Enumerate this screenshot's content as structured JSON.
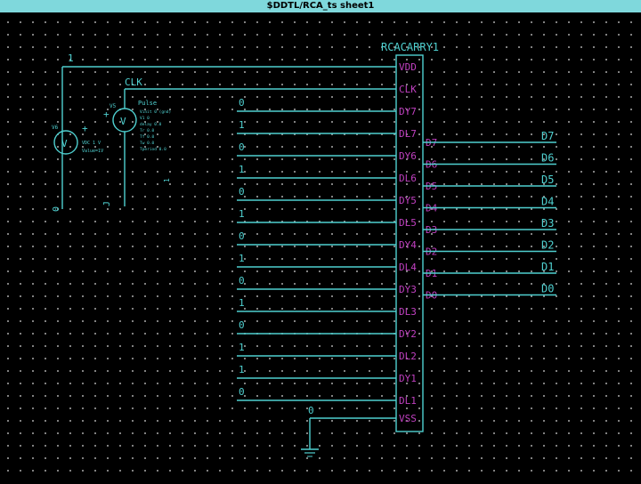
{
  "window": {
    "title": "$DDTL/RCA_ts sheet1"
  },
  "colors": {
    "wire": "#4fd0d0",
    "pin_label": "#c040c0",
    "component": "#4fd0d0",
    "text": "#4fd0d0",
    "grid_dot": "#9a9a9a",
    "background": "#000000",
    "titlebar": "#7fd8dc"
  },
  "vdd_source": {
    "value": "1"
  },
  "clock_source": {
    "net_label": "CLK",
    "ref": "V5",
    "symbol": "V",
    "func": "Pulse",
    "params": [
      "Vinit 0 (gnd)",
      "V1 0",
      "delay 0.0",
      "Tr 0.0",
      "Tf 0.0",
      "Tw 0.0",
      "Tperiod 0.0"
    ],
    "side_value": "1",
    "bottom_value": "J",
    "vdc_ref": "V6",
    "vdc_label": "V",
    "gnd_value": "0",
    "vdc_text": "VDC 1 V",
    "vdc_sub": "Value=1V"
  },
  "inputs": [
    {
      "value": "0",
      "pin": "DY7"
    },
    {
      "value": "1",
      "pin": "DL7"
    },
    {
      "value": "0",
      "pin": "DY6"
    },
    {
      "value": "1",
      "pin": "DL6"
    },
    {
      "value": "0",
      "pin": "DY5"
    },
    {
      "value": "1",
      "pin": "DL5"
    },
    {
      "value": "0",
      "pin": "DY4"
    },
    {
      "value": "1",
      "pin": "DL4"
    },
    {
      "value": "0",
      "pin": "DY3"
    },
    {
      "value": "1",
      "pin": "DL3"
    },
    {
      "value": "0",
      "pin": "DY2"
    },
    {
      "value": "1",
      "pin": "DL2"
    },
    {
      "value": "1",
      "pin": "DY1"
    },
    {
      "value": "0",
      "pin": "DL1"
    }
  ],
  "component": {
    "name": "RCACARRY1",
    "top_pins": [
      "VDD",
      "CLK"
    ],
    "bottom_pin": "VSS",
    "out_pins": [
      "D7",
      "D6",
      "D5",
      "D4",
      "D3",
      "D2",
      "D1",
      "D0"
    ]
  },
  "outputs": [
    "D7",
    "D6",
    "D5",
    "D4",
    "D3",
    "D2",
    "D1",
    "D0"
  ],
  "vss_source": {
    "value": "0"
  }
}
